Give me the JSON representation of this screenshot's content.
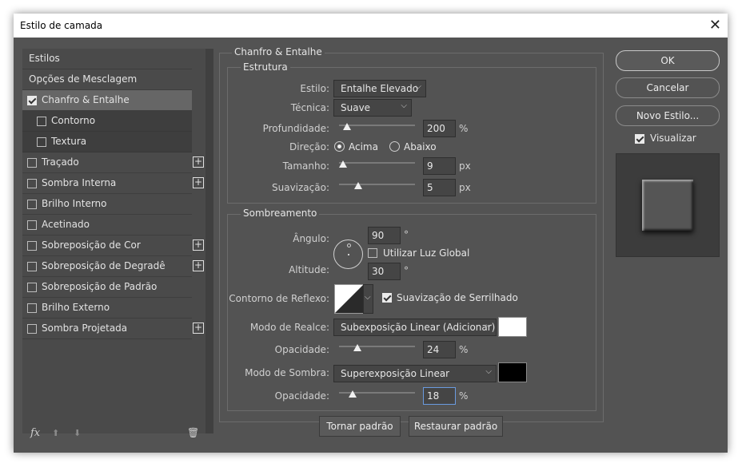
{
  "window": {
    "title": "Estilo de camada",
    "close_glyph": "✕"
  },
  "left": {
    "items": [
      {
        "label": "Estilos",
        "checkbox": false,
        "plus": false,
        "kind": "plain"
      },
      {
        "label": "Opções de Mesclagem",
        "checkbox": false,
        "plus": false,
        "kind": "plain"
      },
      {
        "label": "Chanfro & Entalhe",
        "checkbox": true,
        "checked": true,
        "plus": false,
        "kind": "selected"
      },
      {
        "label": "Contorno",
        "checkbox": true,
        "checked": false,
        "plus": false,
        "kind": "sub"
      },
      {
        "label": "Textura",
        "checkbox": true,
        "checked": false,
        "plus": false,
        "kind": "sub"
      },
      {
        "label": "Traçado",
        "checkbox": true,
        "checked": false,
        "plus": true,
        "kind": "plain"
      },
      {
        "label": "Sombra Interna",
        "checkbox": true,
        "checked": false,
        "plus": true,
        "kind": "plain"
      },
      {
        "label": "Brilho Interno",
        "checkbox": true,
        "checked": false,
        "plus": false,
        "kind": "plain"
      },
      {
        "label": "Acetinado",
        "checkbox": true,
        "checked": false,
        "plus": false,
        "kind": "plain"
      },
      {
        "label": "Sobreposição de Cor",
        "checkbox": true,
        "checked": false,
        "plus": true,
        "kind": "plain"
      },
      {
        "label": "Sobreposição de Degradê",
        "checkbox": true,
        "checked": false,
        "plus": true,
        "kind": "plain"
      },
      {
        "label": "Sobreposição de Padrão",
        "checkbox": true,
        "checked": false,
        "plus": false,
        "kind": "plain"
      },
      {
        "label": "Brilho Externo",
        "checkbox": true,
        "checked": false,
        "plus": false,
        "kind": "plain"
      },
      {
        "label": "Sombra Projetada",
        "checkbox": true,
        "checked": false,
        "plus": true,
        "kind": "plain"
      }
    ],
    "plus_glyph": "+",
    "fx_label": "fx",
    "up_glyph": "⬆",
    "down_glyph": "⬇",
    "trash_glyph": "🗑"
  },
  "main": {
    "section_title": "Chanfro & Entalhe",
    "estrutura": {
      "title": "Estrutura",
      "estilo_label": "Estilo:",
      "estilo_value": "Entalhe Elevado",
      "tecnica_label": "Técnica:",
      "tecnica_value": "Suave",
      "profundidade_label": "Profundidade:",
      "profundidade_value": "200",
      "profundidade_unit": "%",
      "profundidade_slider": 0.1,
      "direcao_label": "Direção:",
      "direcao_acima": "Acima",
      "direcao_abaixo": "Abaixo",
      "tamanho_label": "Tamanho:",
      "tamanho_value": "9",
      "tamanho_unit": "px",
      "tamanho_slider": 0.05,
      "suavizacao_label": "Suavização:",
      "suavizacao_value": "5",
      "suavizacao_unit": "px",
      "suavizacao_slider": 0.25
    },
    "sombreamento": {
      "title": "Sombreamento",
      "angulo_label": "Ângulo:",
      "angulo_value": "90",
      "degree": "°",
      "luz_global_label": "Utilizar Luz Global",
      "altitude_label": "Altitude:",
      "altitude_value": "30",
      "contorno_label": "Contorno de Reflexo:",
      "serrilhado_label": "Suavização de Serrilhado",
      "realce_label": "Modo de Realce:",
      "realce_value": "Subexposição Linear (Adicionar)",
      "realce_color": "#ffffff",
      "opacidade1_label": "Opacidade:",
      "opacidade1_value": "24",
      "opacidade1_slider": 0.24,
      "sombra_label": "Modo de Sombra:",
      "sombra_value": "Superexposição Linear",
      "sombra_color": "#000000",
      "opacidade2_label": "Opacidade:",
      "opacidade2_value": "18",
      "opacidade2_slider": 0.18,
      "percent": "%"
    },
    "tornar_padrao": "Tornar padrão",
    "restaurar_padrao": "Restaurar padrão"
  },
  "right": {
    "ok": "OK",
    "cancelar": "Cancelar",
    "novo_estilo": "Novo Estilo...",
    "visualizar": "Visualizar"
  }
}
